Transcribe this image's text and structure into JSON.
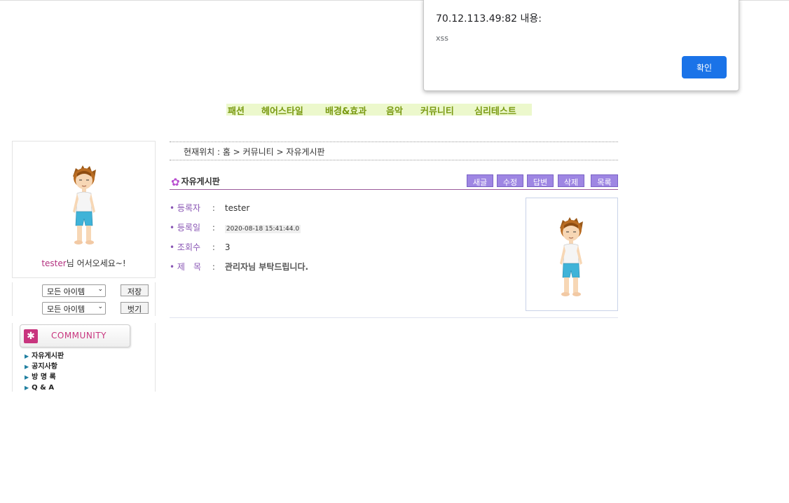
{
  "alert": {
    "title": "70.12.113.49:82 내용:",
    "message": "xss",
    "ok_label": "확인"
  },
  "top_menu": [
    "패션",
    "헤어스타일",
    "배경&효과",
    "음악",
    "커뮤니티",
    "심리테스트"
  ],
  "profile": {
    "username": "tester",
    "welcome_suffix": "님 어서오세요~!"
  },
  "item_controls": {
    "select1": "모든 아이템",
    "select2": "모든 아이템",
    "save_label": "저장",
    "undress_label": "벗기"
  },
  "community": {
    "banner": "COMMUNITY",
    "items": [
      "자유게시판",
      "공지사항",
      "방 명 록",
      "Q & A"
    ]
  },
  "breadcrumb": "현재위치 : 홈 > 커뮤니티 > 자유게시판",
  "board": {
    "title": "자유게시판",
    "buttons": [
      "새글",
      "수정",
      "답변",
      "삭제",
      "목록"
    ]
  },
  "post": {
    "author_label": "등록자",
    "author": "tester",
    "date_label": "등록일",
    "date": "2020-08-18 15:41:44.0",
    "views_label": "조회수",
    "views": "3",
    "subject_label": "제　목",
    "subject": "관리자님 부탁드립니다."
  },
  "colors": {
    "accent_purple": "#9e86e3",
    "menu_green": "#7a9a12",
    "menu_bg": "#ecf8cc",
    "community_pink": "#c8357e",
    "alert_blue": "#1a73e8"
  }
}
